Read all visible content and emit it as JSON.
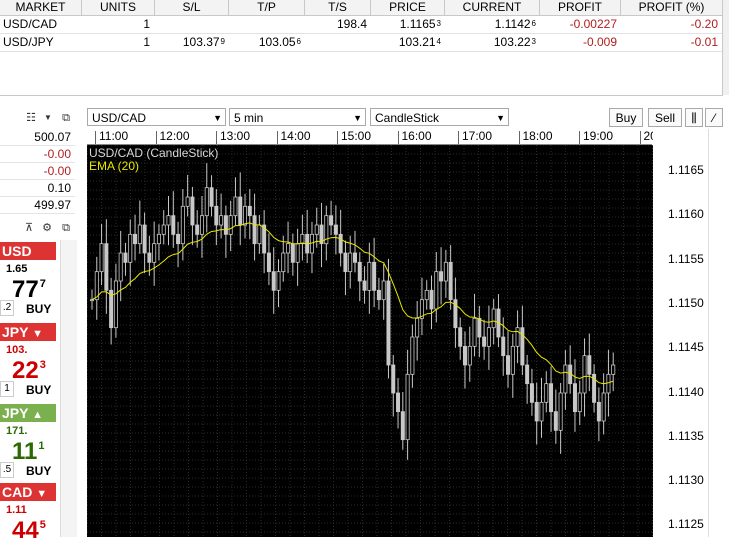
{
  "positions": {
    "columns": [
      "MARKET",
      "UNITS",
      "S/L",
      "T/P",
      "T/S",
      "PRICE",
      "CURRENT",
      "PROFIT",
      "PROFIT (%)"
    ],
    "rows": [
      {
        "market": "USD/CAD",
        "units": "1",
        "sl": "",
        "sl_sup": "",
        "tp": "",
        "tp_sup": "",
        "ts": "198.4",
        "price": "1.1165",
        "price_sup": "3",
        "current": "1.1142",
        "current_sup": "6",
        "profit": "-0.00227",
        "profit_pct": "-0.20"
      },
      {
        "market": "USD/JPY",
        "units": "1",
        "sl": "103.37",
        "sl_sup": "9",
        "tp": "103.05",
        "tp_sup": "6",
        "ts": "",
        "price": "103.21",
        "price_sup": "4",
        "current": "103.22",
        "current_sup": "3",
        "profit": "-0.009",
        "profit_pct": "-0.01"
      }
    ]
  },
  "account": {
    "values": [
      "500.07",
      "-0.00",
      "-0.00",
      "0.10",
      "499.97"
    ]
  },
  "tiles": [
    {
      "pair": "USD",
      "bid": "1.65",
      "big": "77",
      "sup": "7",
      "small": ".2",
      "buy": "BUY",
      "dir": "none",
      "color": "#d33"
    },
    {
      "pair": "JPY",
      "bid": "103.",
      "big": "22",
      "sup": "3",
      "small": "1",
      "buy": "BUY",
      "dir": "down",
      "color": "#d33"
    },
    {
      "pair": "JPY",
      "bid": "171.",
      "big": "11",
      "sup": "1",
      "small": ".5",
      "buy": "BUY",
      "dir": "up",
      "color": "#7ab04e"
    },
    {
      "pair": "CAD",
      "bid": "1.11",
      "big": "44",
      "sup": "5",
      "small": "",
      "buy": "",
      "dir": "down",
      "color": "#d33"
    }
  ],
  "chart_toolbar": {
    "symbol": "USD/CAD",
    "interval": "5 min",
    "style": "CandleStick",
    "buy": "Buy",
    "sell": "Sell"
  },
  "chart": {
    "legend_main": "USD/CAD (CandleStick)",
    "legend_ema": "EMA (20)",
    "time_labels": [
      "11:00",
      "12:00",
      "13:00",
      "14:00",
      "15:00",
      "16:00",
      "17:00",
      "18:00",
      "19:00",
      "20"
    ],
    "price_labels": [
      "1.1165",
      "1.1160",
      "1.1155",
      "1.1150",
      "1.1145",
      "1.1140",
      "1.1135",
      "1.1130",
      "1.1125"
    ],
    "colors": {
      "background": "#000000",
      "candle": "#c8c8c8",
      "ema": "#e8e800",
      "grid": "#2a2a2a"
    }
  },
  "chart_data": {
    "type": "candlestick",
    "symbol": "USD/CAD",
    "interval": "5 min",
    "closes": [
      1.115,
      1.1153,
      1.1156,
      1.1151,
      1.1147,
      1.1152,
      1.1155,
      1.1154,
      1.1157,
      1.1156,
      1.1158,
      1.1155,
      1.1154,
      1.1156,
      1.1157,
      1.1158,
      1.1159,
      1.1157,
      1.1156,
      1.116,
      1.1161,
      1.1158,
      1.1157,
      1.1159,
      1.1162,
      1.116,
      1.1158,
      1.1159,
      1.1157,
      1.1159,
      1.1161,
      1.1158,
      1.116,
      1.1159,
      1.1156,
      1.1158,
      1.1155,
      1.1153,
      1.1151,
      1.1153,
      1.1155,
      1.1156,
      1.1154,
      1.1156,
      1.1157,
      1.1155,
      1.1157,
      1.1158,
      1.1156,
      1.1159,
      1.1158,
      1.1157,
      1.1155,
      1.1153,
      1.1155,
      1.1154,
      1.1152,
      1.1151,
      1.1154,
      1.1151,
      1.115,
      1.1152,
      1.1143,
      1.114,
      1.1138,
      1.1135,
      1.1142,
      1.1146,
      1.1148,
      1.115,
      1.1151,
      1.1149,
      1.1153,
      1.1152,
      1.1154,
      1.115,
      1.1147,
      1.1145,
      1.1143,
      1.1145,
      1.1148,
      1.1146,
      1.1145,
      1.1147,
      1.1149,
      1.1146,
      1.1144,
      1.1142,
      1.1145,
      1.1147,
      1.1143,
      1.1141,
      1.1139,
      1.1137,
      1.1139,
      1.1141,
      1.1138,
      1.1136,
      1.114,
      1.1143,
      1.1141,
      1.1138,
      1.114,
      1.1144,
      1.1142,
      1.1139,
      1.1137,
      1.114,
      1.1142,
      1.1143
    ],
    "ema_period": 20,
    "ylim": [
      1.1125,
      1.1167
    ]
  }
}
